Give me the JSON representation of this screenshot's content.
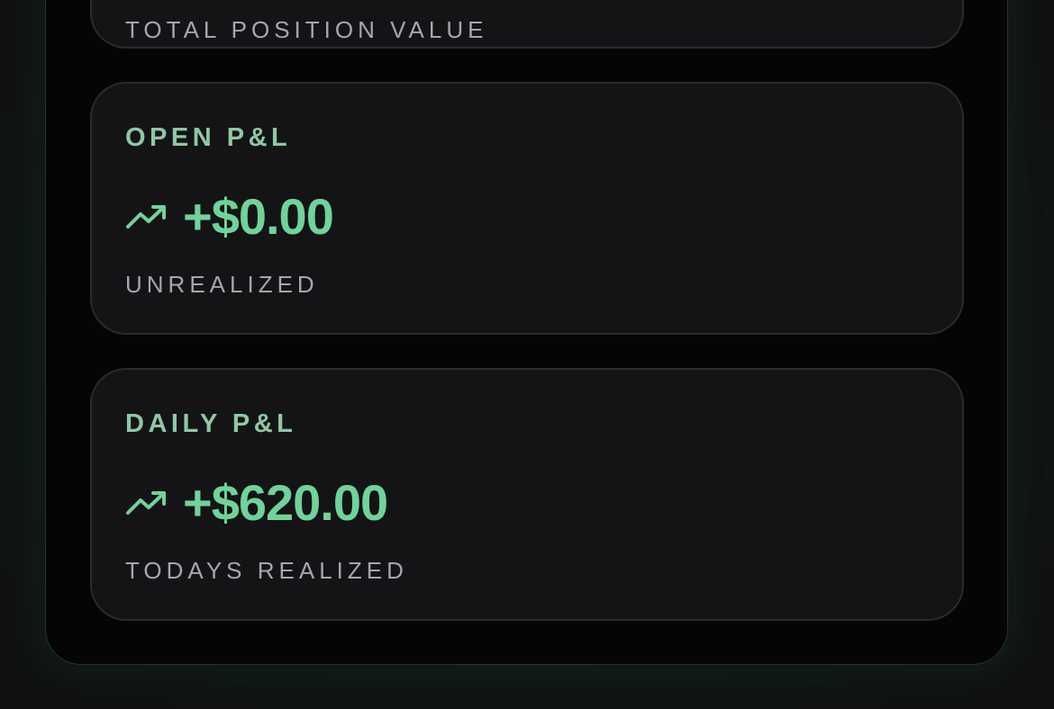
{
  "position_card": {
    "caption": "TOTAL POSITION VALUE"
  },
  "open_pnl": {
    "title": "OPEN P&L",
    "value": "+$0.00",
    "caption": "UNREALIZED",
    "icon": "trending-up-icon"
  },
  "daily_pnl": {
    "title": "DAILY P&L",
    "value": "+$620.00",
    "caption": "TODAYS REALIZED",
    "icon": "trending-up-icon"
  },
  "colors": {
    "accent_green": "#6fd39a",
    "title_green": "#8ec8a2",
    "card_bg": "#141416",
    "panel_bg": "#050506"
  }
}
